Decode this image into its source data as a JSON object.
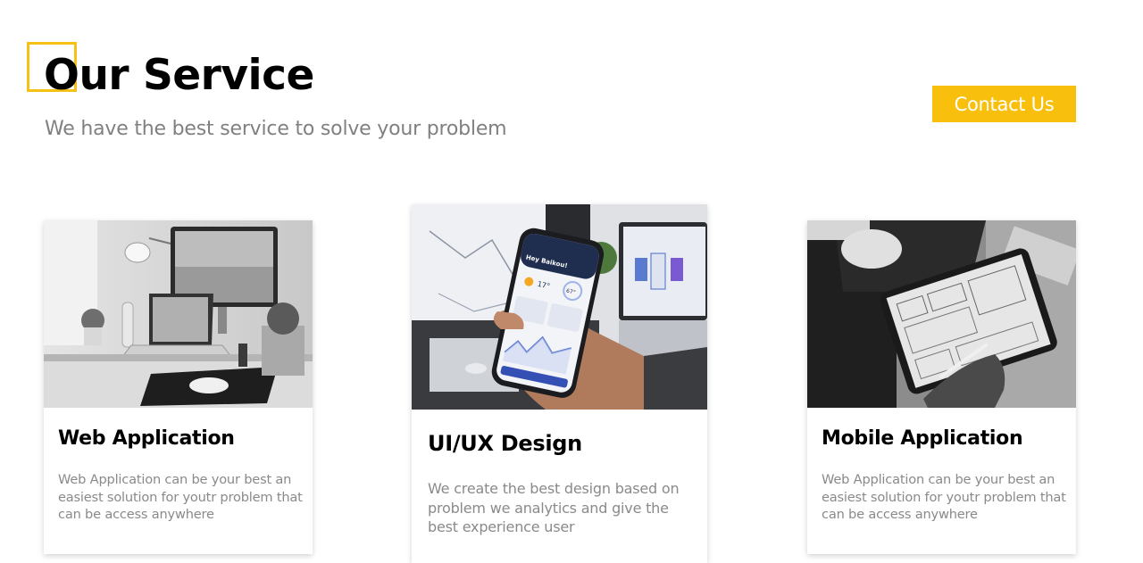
{
  "header": {
    "title": "Our Service",
    "subtitle": "We have the best service to solve your problem",
    "accent_color": "#F5C115"
  },
  "contact_button": {
    "label": "Contact Us",
    "color": "#F8C00D"
  },
  "services": [
    {
      "title": "Web Application",
      "description": "Web Application can be your best an easiest solution for youtr problem that can be access anywhere",
      "image": "desk-with-monitor-and-laptop-photo"
    },
    {
      "title": "UI/UX Design",
      "description": "We create the best design based on problem we analytics and give the best experience user",
      "image": "hand-holding-phone-with-app-photo",
      "phone_screen": {
        "greeting": "Hey Baikou!",
        "temp_value": "17°",
        "reading_value": "67°"
      }
    },
    {
      "title": "Mobile Application",
      "description": "Web Application can be your best an easiest solution for youtr problem that can be access anywhere",
      "image": "tablet-wireframe-sketch-photo"
    }
  ]
}
